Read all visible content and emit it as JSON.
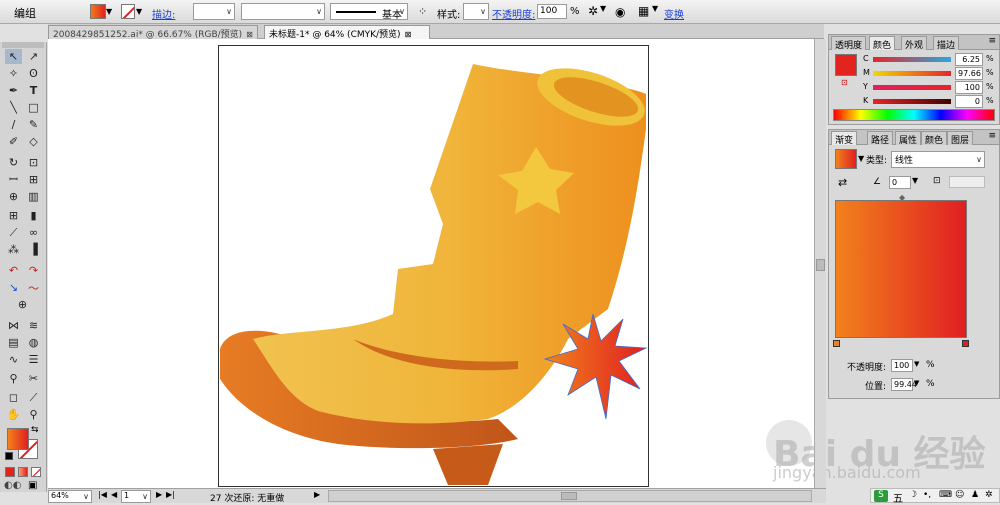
{
  "control_bar": {
    "mode_label": "编组",
    "stroke_link": "描边:",
    "basic_label": "基本",
    "style_label": "样式:",
    "opacity_link": "不透明度:",
    "opacity_value": "100",
    "opacity_unit": "%",
    "transform_link": "变换"
  },
  "doc_tabs": [
    {
      "label": "2008429851252.ai* @ 66.67% (RGB/预览)",
      "active": false
    },
    {
      "label": "未标题-1* @ 64% (CMYK/预览)",
      "active": true
    }
  ],
  "color_panel": {
    "tabs": [
      "透明度",
      "颜色",
      "外观",
      "描边"
    ],
    "active_tab": "颜色",
    "channels": [
      {
        "name": "C",
        "value": "6.25",
        "gradient": "#e8232a"
      },
      {
        "name": "M",
        "value": "97.66",
        "gradient": "#f3d600"
      },
      {
        "name": "Y",
        "value": "100",
        "gradient": "#e8232a"
      },
      {
        "name": "K",
        "value": "0",
        "gradient": "#555"
      }
    ],
    "fill_color": "#e3231e"
  },
  "gradient_panel": {
    "tabs": [
      "渐变",
      "路径",
      "属性",
      "颜色",
      "图层"
    ],
    "active_tab": "渐变",
    "type_label": "类型:",
    "type_value": "线性",
    "angle_value": "0",
    "opacity_label": "不透明度:",
    "opacity_value": "100",
    "position_label": "位置:",
    "position_value": "99.44",
    "percent": "%",
    "start_color": "#f2811c",
    "end_color": "#e01f22"
  },
  "status_bar": {
    "zoom": "64%",
    "artboard": "1",
    "message": "27 次还原: 无重做"
  },
  "watermark": {
    "brand": "Bai du 经验",
    "url": "jingyan.baidu.com"
  },
  "tray": {
    "ime_label": "五"
  }
}
